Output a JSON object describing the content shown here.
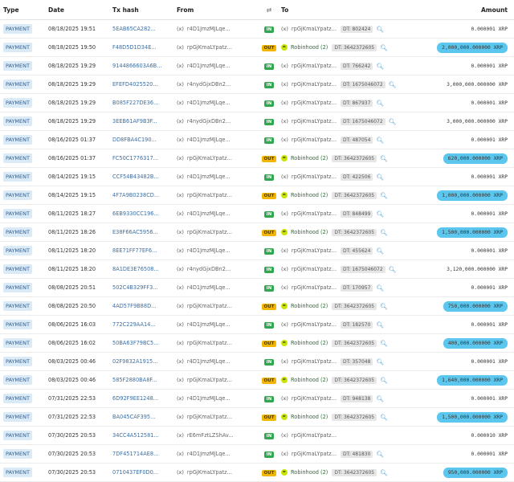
{
  "columns": {
    "type": "Type",
    "date": "Date",
    "hash": "Tx hash",
    "from": "From",
    "dir_icon": "⇄",
    "to": "To",
    "amount": "Amount"
  },
  "rows": [
    {
      "type": "PAYMENT",
      "date": "08/18/2025",
      "time": "19:51",
      "hash": "5EAB65CA282...",
      "from": "r4D1JmzMJLqe...",
      "dir": "IN",
      "to_icon": "(x)",
      "to": "rpGjKmaLYpatz...",
      "to_robin": false,
      "dt": "DT: 802424",
      "amount": "0.000001 XRP",
      "highlight": false
    },
    {
      "type": "PAYMENT",
      "date": "08/18/2025",
      "time": "19:50",
      "hash": "F48D5D1D34E...",
      "from": "rpGjKmaLYpatz...",
      "dir": "OUT",
      "to_icon": "",
      "to": "Robinhood (2)",
      "to_robin": true,
      "dt": "DT: 3642372605",
      "amount": "2,000,000.000000 XRP",
      "highlight": true
    },
    {
      "type": "PAYMENT",
      "date": "08/18/2025",
      "time": "19:29",
      "hash": "9144866603A6B...",
      "from": "r4D1JmzMJLqe...",
      "dir": "IN",
      "to_icon": "(x)",
      "to": "rpGjKmaLYpatz...",
      "to_robin": false,
      "dt": "DT: 766242",
      "amount": "0.000001 XRP",
      "highlight": false
    },
    {
      "type": "PAYMENT",
      "date": "08/18/2025",
      "time": "19:29",
      "hash": "EFEFD4025520...",
      "from": "r4nydGjxDBn2...",
      "dir": "IN",
      "to_icon": "(x)",
      "to": "rpGjKmaLYpatz...",
      "to_robin": false,
      "dt": "DT: 1675046072",
      "amount": "3,000,000.000000 XRP",
      "highlight": false
    },
    {
      "type": "PAYMENT",
      "date": "08/18/2025",
      "time": "19:29",
      "hash": "B085F227DE36...",
      "from": "r4D1JmzMJLqe...",
      "dir": "IN",
      "to_icon": "(x)",
      "to": "rpGjKmaLYpatz...",
      "to_robin": false,
      "dt": "DT: 867937",
      "amount": "0.000001 XRP",
      "highlight": false
    },
    {
      "type": "PAYMENT",
      "date": "08/18/2025",
      "time": "19:29",
      "hash": "3EEB61AF9B3F...",
      "from": "r4nydGjxDBn2...",
      "dir": "IN",
      "to_icon": "(x)",
      "to": "rpGjKmaLYpatz...",
      "to_robin": false,
      "dt": "DT: 1675046072",
      "amount": "3,000,000.000000 XRP",
      "highlight": false
    },
    {
      "type": "PAYMENT",
      "date": "08/16/2025",
      "time": "01:37",
      "hash": "DD8FBA4C190...",
      "from": "r4D1JmzMJLqe...",
      "dir": "IN",
      "to_icon": "(x)",
      "to": "rpGjKmaLYpatz...",
      "to_robin": false,
      "dt": "DT: 487054",
      "amount": "0.000001 XRP",
      "highlight": false
    },
    {
      "type": "PAYMENT",
      "date": "08/16/2025",
      "time": "01:37",
      "hash": "FC50C1776317...",
      "from": "rpGjKmaLYpatz...",
      "dir": "OUT",
      "to_icon": "",
      "to": "Robinhood (2)",
      "to_robin": true,
      "dt": "DT: 3642372605",
      "amount": "620,000.000000 XRP",
      "highlight": true
    },
    {
      "type": "PAYMENT",
      "date": "08/14/2025",
      "time": "19:15",
      "hash": "CCF54B43482B...",
      "from": "r4D1JmzMJLqe...",
      "dir": "IN",
      "to_icon": "(x)",
      "to": "rpGjKmaLYpatz...",
      "to_robin": false,
      "dt": "DT: 422506",
      "amount": "0.000001 XRP",
      "highlight": false
    },
    {
      "type": "PAYMENT",
      "date": "08/14/2025",
      "time": "19:15",
      "hash": "4F7A9B0238CD...",
      "from": "rpGjKmaLYpatz...",
      "dir": "OUT",
      "to_icon": "",
      "to": "Robinhood (2)",
      "to_robin": true,
      "dt": "DT: 3642372605",
      "amount": "1,000,000.000000 XRP",
      "highlight": true
    },
    {
      "type": "PAYMENT",
      "date": "08/11/2025",
      "time": "18:27",
      "hash": "6EB9330CC196...",
      "from": "r4D1JmzMJLqe...",
      "dir": "IN",
      "to_icon": "(x)",
      "to": "rpGjKmaLYpatz...",
      "to_robin": false,
      "dt": "DT: 848499",
      "amount": "0.000001 XRP",
      "highlight": false
    },
    {
      "type": "PAYMENT",
      "date": "08/11/2025",
      "time": "18:26",
      "hash": "E38F66AC5956...",
      "from": "rpGjKmaLYpatz...",
      "dir": "OUT",
      "to_icon": "",
      "to": "Robinhood (2)",
      "to_robin": true,
      "dt": "DT: 3642372605",
      "amount": "1,500,000.000000 XRP",
      "highlight": true
    },
    {
      "type": "PAYMENT",
      "date": "08/11/2025",
      "time": "18:20",
      "hash": "8EE71FF77EF6...",
      "from": "r4D1JmzMJLqe...",
      "dir": "IN",
      "to_icon": "(x)",
      "to": "rpGjKmaLYpatz...",
      "to_robin": false,
      "dt": "DT: 455624",
      "amount": "0.000001 XRP",
      "highlight": false
    },
    {
      "type": "PAYMENT",
      "date": "08/11/2025",
      "time": "18:20",
      "hash": "8A1DE3E76508...",
      "from": "r4nydGjxDBn2...",
      "dir": "IN",
      "to_icon": "(x)",
      "to": "rpGjKmaLYpatz...",
      "to_robin": false,
      "dt": "DT: 1675046072",
      "amount": "3,120,000.000000 XRP",
      "highlight": false
    },
    {
      "type": "PAYMENT",
      "date": "08/08/2025",
      "time": "20:51",
      "hash": "502C4B329FF3...",
      "from": "r4D1JmzMJLqe...",
      "dir": "IN",
      "to_icon": "(x)",
      "to": "rpGjKmaLYpatz...",
      "to_robin": false,
      "dt": "DT: 170957",
      "amount": "0.000001 XRP",
      "highlight": false
    },
    {
      "type": "PAYMENT",
      "date": "08/08/2025",
      "time": "20:50",
      "hash": "4AD57F9B88D...",
      "from": "rpGjKmaLYpatz...",
      "dir": "OUT",
      "to_icon": "",
      "to": "Robinhood (2)",
      "to_robin": true,
      "dt": "DT: 3642372605",
      "amount": "750,000.000000 XRP",
      "highlight": true
    },
    {
      "type": "PAYMENT",
      "date": "08/06/2025",
      "time": "16:03",
      "hash": "772C229AA14...",
      "from": "r4D1JmzMJLqe...",
      "dir": "IN",
      "to_icon": "(x)",
      "to": "rpGjKmaLYpatz...",
      "to_robin": false,
      "dt": "DT: 182570",
      "amount": "0.000001 XRP",
      "highlight": false
    },
    {
      "type": "PAYMENT",
      "date": "08/06/2025",
      "time": "16:02",
      "hash": "50BA63F79BC5...",
      "from": "rpGjKmaLYpatz...",
      "dir": "OUT",
      "to_icon": "",
      "to": "Robinhood (2)",
      "to_robin": true,
      "dt": "DT: 3642372605",
      "amount": "400,000.000000 XRP",
      "highlight": true
    },
    {
      "type": "PAYMENT",
      "date": "08/03/2025",
      "time": "00:46",
      "hash": "02F9832A1915...",
      "from": "r4D1JmzMJLqe...",
      "dir": "IN",
      "to_icon": "(x)",
      "to": "rpGjKmaLYpatz...",
      "to_robin": false,
      "dt": "DT: 357048",
      "amount": "0.000001 XRP",
      "highlight": false
    },
    {
      "type": "PAYMENT",
      "date": "08/03/2025",
      "time": "00:46",
      "hash": "585F2880BA8F...",
      "from": "rpGjKmaLYpatz...",
      "dir": "OUT",
      "to_icon": "",
      "to": "Robinhood (2)",
      "to_robin": true,
      "dt": "DT: 3642372605",
      "amount": "1,640,000.000000 XRP",
      "highlight": true
    },
    {
      "type": "PAYMENT",
      "date": "07/31/2025",
      "time": "22:53",
      "hash": "6D92F9EE1248...",
      "from": "r4D1JmzMJLqe...",
      "dir": "IN",
      "to_icon": "(x)",
      "to": "rpGjKmaLYpatz...",
      "to_robin": false,
      "dt": "DT: 948138",
      "amount": "0.000001 XRP",
      "highlight": false
    },
    {
      "type": "PAYMENT",
      "date": "07/31/2025",
      "time": "22:53",
      "hash": "BA045CAF395...",
      "from": "rpGjKmaLYpatz...",
      "dir": "OUT",
      "to_icon": "",
      "to": "Robinhood (2)",
      "to_robin": true,
      "dt": "DT: 3642372605",
      "amount": "1,500,000.000000 XRP",
      "highlight": true
    },
    {
      "type": "PAYMENT",
      "date": "07/30/2025",
      "time": "20:53",
      "hash": "34CC4A512581...",
      "from": "rE6mFztLZShAv...",
      "dir": "IN",
      "to_icon": "(x)",
      "to": "rpGjKmaLYpatz...",
      "to_robin": false,
      "dt": "",
      "amount": "0.000010 XRP",
      "highlight": false
    },
    {
      "type": "PAYMENT",
      "date": "07/30/2025",
      "time": "20:53",
      "hash": "7DF451714AE8...",
      "from": "r4D1JmzMJLqe...",
      "dir": "IN",
      "to_icon": "(x)",
      "to": "rpGjKmaLYpatz...",
      "to_robin": false,
      "dt": "DT: 481830",
      "amount": "0.000001 XRP",
      "highlight": false
    },
    {
      "type": "PAYMENT",
      "date": "07/30/2025",
      "time": "20:53",
      "hash": "0710437EF0D0...",
      "from": "rpGjKmaLYpatz...",
      "dir": "OUT",
      "to_icon": "",
      "to": "Robinhood (2)",
      "to_robin": true,
      "dt": "DT: 3642372605",
      "amount": "950,000.000000 XRP",
      "highlight": true
    }
  ]
}
